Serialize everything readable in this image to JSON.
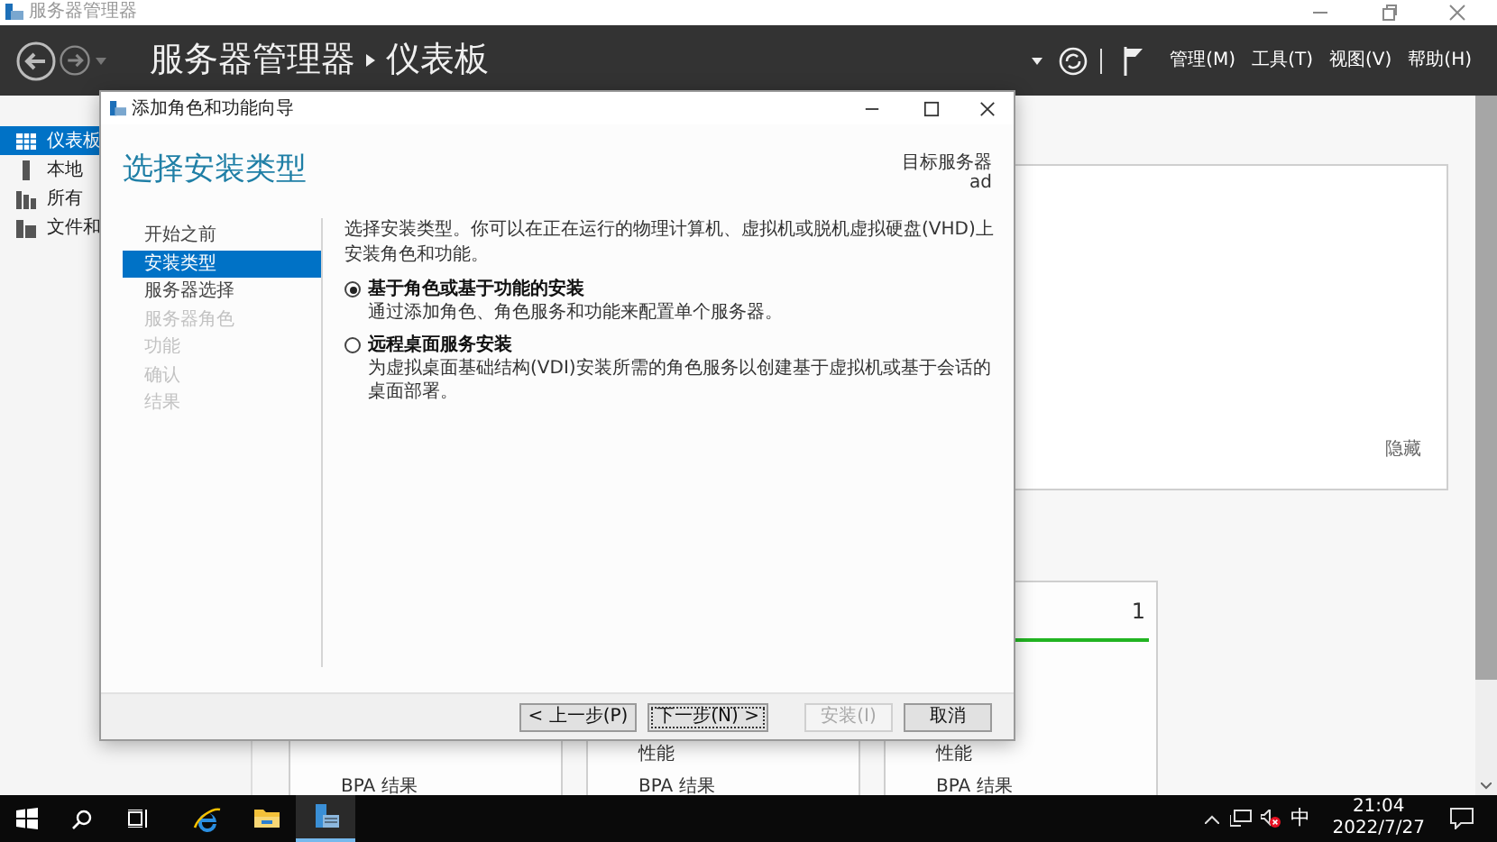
{
  "window": {
    "title": "服务器管理器"
  },
  "header": {
    "breadcrumb": [
      "服务器管理器",
      "仪表板"
    ],
    "menus": [
      "管理(M)",
      "工具(T)",
      "视图(V)",
      "帮助(H)"
    ]
  },
  "sidebar": {
    "items": [
      {
        "label": "仪表板",
        "selected": true
      },
      {
        "label": "本地",
        "selected": false
      },
      {
        "label": "所有",
        "selected": false
      },
      {
        "label": "文件和",
        "selected": false
      }
    ]
  },
  "panel": {
    "hide_link": "隐藏"
  },
  "tiles": [
    {
      "lines": [
        "BPA 结果"
      ]
    },
    {
      "lines": [
        "性能",
        "BPA 结果"
      ]
    },
    {
      "count": "1",
      "color": "#22b422",
      "lines": [
        "性能",
        "BPA 结果"
      ]
    }
  ],
  "dialog": {
    "title": "添加角色和功能向导",
    "heading": "选择安装类型",
    "target_label": "目标服务器",
    "target_value": "ad",
    "steps": [
      {
        "label": "开始之前",
        "selected": false,
        "disabled": false
      },
      {
        "label": "安装类型",
        "selected": true,
        "disabled": false
      },
      {
        "label": "服务器选择",
        "selected": false,
        "disabled": false
      },
      {
        "label": "服务器角色",
        "selected": false,
        "disabled": true
      },
      {
        "label": "功能",
        "selected": false,
        "disabled": true
      },
      {
        "label": "确认",
        "selected": false,
        "disabled": true
      },
      {
        "label": "结果",
        "selected": false,
        "disabled": true
      }
    ],
    "description": "选择安装类型。你可以在正在运行的物理计算机、虚拟机或脱机虚拟硬盘(VHD)上安装角色和功能。",
    "options": [
      {
        "title": "基于角色或基于功能的安装",
        "description": "通过添加角色、角色服务和功能来配置单个服务器。",
        "selected": true
      },
      {
        "title": "远程桌面服务安装",
        "description": "为虚拟桌面基础结构(VDI)安装所需的角色服务以创建基于虚拟机或基于会话的桌面部署。",
        "selected": false
      }
    ],
    "buttons": [
      {
        "label": "< 上一步(P)",
        "disabled": false,
        "focused": false
      },
      {
        "label": "下一步(N) >",
        "disabled": false,
        "focused": true
      },
      {
        "label": "安装(I)",
        "disabled": true,
        "focused": false
      },
      {
        "label": "取消",
        "disabled": false,
        "focused": false
      }
    ]
  },
  "taskbar": {
    "apps": [
      {
        "kind": "browser",
        "selected": false
      },
      {
        "kind": "folder",
        "selected": false
      },
      {
        "kind": "server",
        "selected": true
      }
    ],
    "ime": "中",
    "time": "21:04",
    "date": "2022/7/27"
  }
}
